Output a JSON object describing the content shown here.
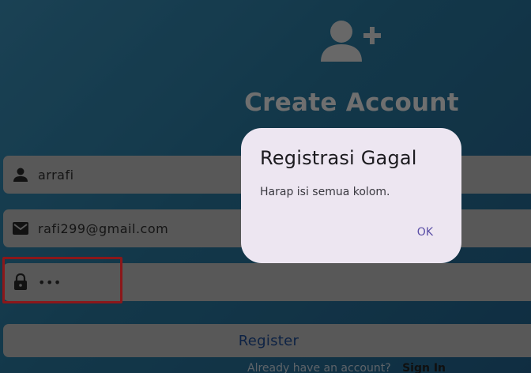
{
  "header": {
    "icon": "person-add-icon",
    "title": "Create Account"
  },
  "form": {
    "username": {
      "icon": "person-icon",
      "value": "arrafi"
    },
    "email": {
      "icon": "mail-icon",
      "value": "rafi299@gmail.com"
    },
    "password": {
      "icon": "lock-icon",
      "value": "•••"
    },
    "register_label": "Register",
    "signin_prompt": "Already have an account?",
    "signin_link": "Sign In"
  },
  "dialog": {
    "title": "Registrasi Gagal",
    "message": "Harap isi semua kolom.",
    "ok_label": "OK"
  },
  "colors": {
    "highlight_border": "#e0262a",
    "dialog_bg": "#ede6f1",
    "ok_text": "#5a4ea6"
  }
}
